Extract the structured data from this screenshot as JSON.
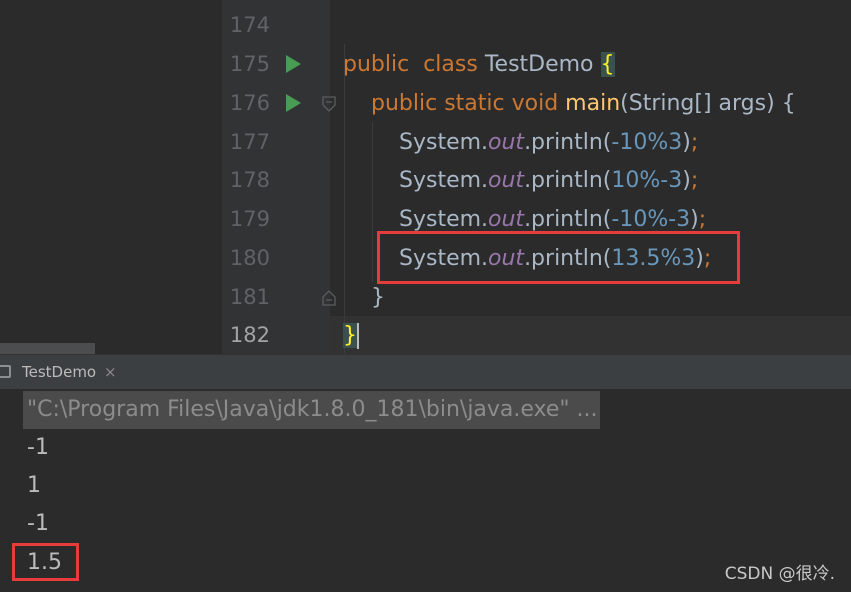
{
  "editor": {
    "line_numbers": [
      "174",
      "175",
      "176",
      "177",
      "178",
      "179",
      "180",
      "181",
      "182"
    ],
    "code": {
      "l175": {
        "kw1": "public",
        "kw2": "class",
        "name": "TestDemo",
        "brace": "{"
      },
      "l176": {
        "kw1": "public",
        "kw2": "static",
        "kw3": "void",
        "fn": "main",
        "params": "(String[] args) {"
      },
      "l177": {
        "pre": "System.",
        "field": "out",
        "call": ".println(",
        "num1": "-10",
        "op": "%",
        "num2": "3",
        "close": ")",
        "semi": ";"
      },
      "l178": {
        "pre": "System.",
        "field": "out",
        "call": ".println(",
        "num1": "10",
        "op": "%",
        "num2": "-3",
        "close": ")",
        "semi": ";"
      },
      "l179": {
        "pre": "System.",
        "field": "out",
        "call": ".println(",
        "num1": "-10",
        "op": "%",
        "num2": "-3",
        "close": ")",
        "semi": ";"
      },
      "l180": {
        "pre": "System.",
        "field": "out",
        "call": ".println(",
        "num1": "13.5",
        "op": "%",
        "num2": "3",
        "close": ")",
        "semi": ";"
      },
      "l181": {
        "brace": "}"
      },
      "l182": {
        "brace": "}"
      }
    }
  },
  "run_window": {
    "tab_label": "TestDemo",
    "close_glyph": "×",
    "command": "\"C:\\Program Files\\Java\\jdk1.8.0_181\\bin\\java.exe\" ...",
    "output": [
      "-1",
      "1",
      "-1",
      "1.5"
    ]
  },
  "watermark": "CSDN @很冷.",
  "colors": {
    "keyword": "#cc7832",
    "method": "#ffc66d",
    "number": "#6897bb",
    "field": "#9876aa",
    "text": "#a9b7c6",
    "highlight_box": "#e63c3c",
    "run_icon": "#499c54"
  }
}
